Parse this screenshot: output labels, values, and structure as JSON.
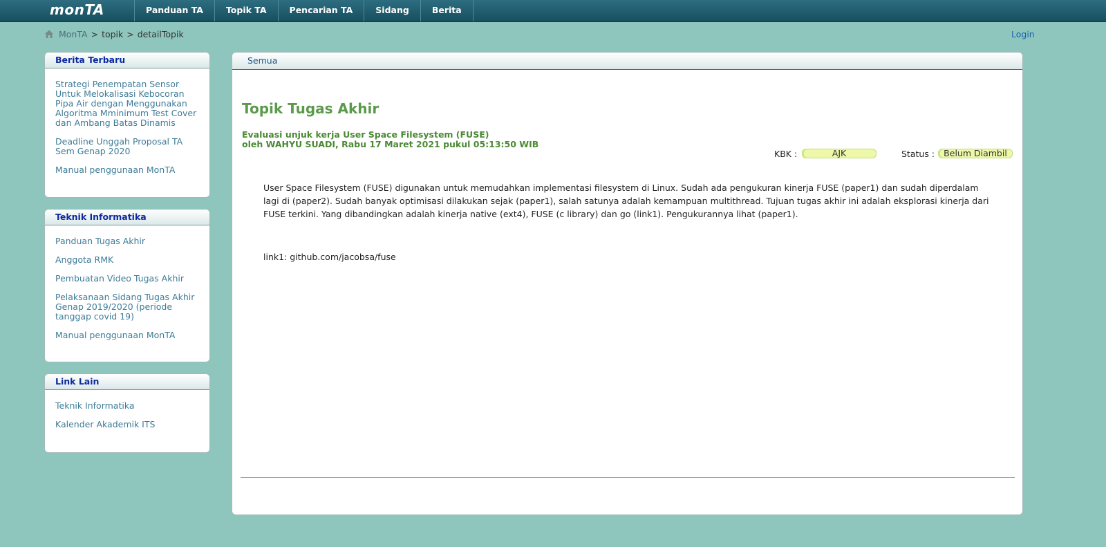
{
  "app": {
    "logo": "monTA"
  },
  "nav": {
    "items": [
      "Panduan TA",
      "Topik TA",
      "Pencarian TA",
      "Sidang",
      "Berita"
    ]
  },
  "breadcrumb": {
    "home": "MonTA",
    "sep": ">",
    "level1": "topik",
    "level2": "detailTopik"
  },
  "header": {
    "login": "Login"
  },
  "sidebar": {
    "berita": {
      "title": "Berita Terbaru",
      "items": [
        "Strategi Penempatan Sensor Untuk Melokalisasi Kebocoran Pipa Air dengan Menggunakan Algoritma Mminimum Test Cover dan Ambang Batas Dinamis",
        "Deadline Unggah Proposal TA Sem Genap 2020",
        "Manual penggunaan MonTA"
      ]
    },
    "teknik": {
      "title": "Teknik Informatika",
      "items": [
        "Panduan Tugas Akhir",
        "Anggota RMK",
        "Pembuatan Video Tugas Akhir",
        "Pelaksanaan Sidang Tugas Akhir Genap 2019/2020 (periode tanggap covid 19)",
        "Manual penggunaan MonTA"
      ]
    },
    "link_lain": {
      "title": "Link Lain",
      "items": [
        "Teknik Informatika",
        "Kalender Akademik ITS"
      ]
    }
  },
  "main": {
    "tab": "Semua",
    "title": "Topik Tugas Akhir",
    "topic_title": "Evaluasi unjuk kerja User Space Filesystem (FUSE)",
    "topic_by": "oleh WAHYU SUADI, Rabu 17 Maret 2021 pukul 05:13:50 WIB",
    "kbk_label": "KBK :",
    "kbk_value": "AJK",
    "status_label": "Status :",
    "status_value": "Belum Diambil",
    "description": "User Space Filesystem (FUSE) digunakan untuk memudahkan implementasi filesystem di Linux. Sudah ada pengukuran kinerja FUSE (paper1) dan sudah diperdalam lagi di (paper2). Sudah banyak optimisasi dilakukan sejak (paper1), salah satunya adalah kemampuan multithread. Tujuan tugas akhir ini adalah eksplorasi kinerja dari FUSE terkini. Yang dibandingkan adalah kinerja native (ext4), FUSE (c library) dan go (link1). Pengukurannya lihat (paper1).",
    "link1": "link1: github.com/jacobsa/fuse"
  }
}
